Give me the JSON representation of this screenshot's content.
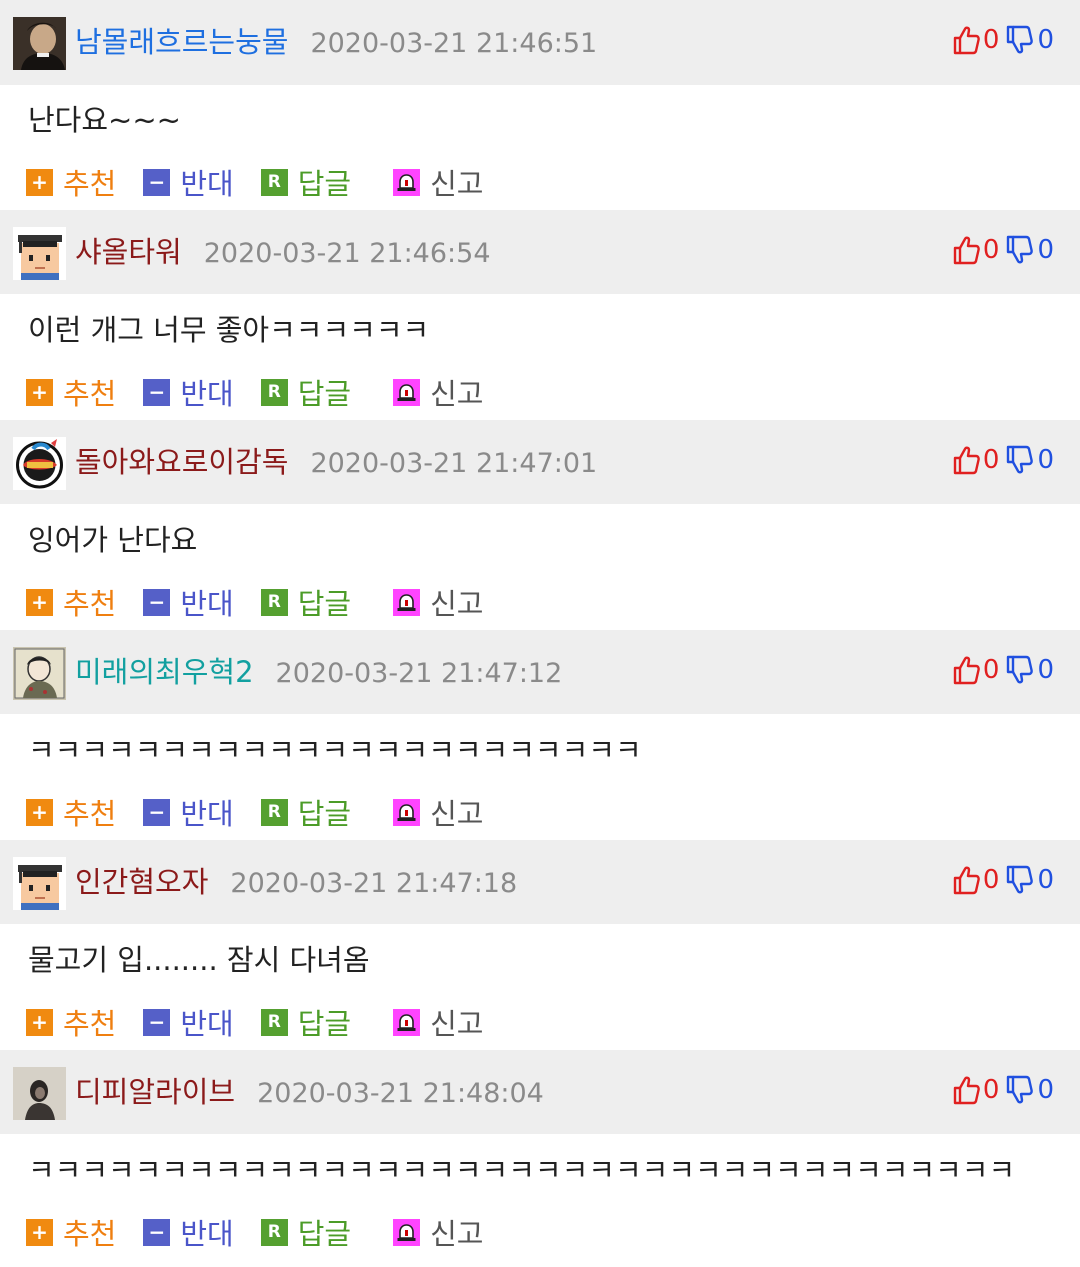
{
  "colors": {
    "header_bg": "#eeeeee",
    "timestamp": "#8a8a8a",
    "upvote": "#e02020",
    "downvote": "#2050e0",
    "recommend": "#f08a10",
    "oppose": "#5560c8",
    "reply": "#55a030",
    "report_icon": "#ff44ff"
  },
  "actions": {
    "recommend_icon": "+",
    "recommend_label": "추천",
    "oppose_icon": "−",
    "oppose_label": "반대",
    "reply_icon": "R",
    "reply_label": "답글",
    "report_icon": "siren-icon",
    "report_label": "신고"
  },
  "comments": [
    {
      "username": "남몰래흐르는눙물",
      "username_color": "#1e6fe0",
      "avatar": "portrait-photo-avatar",
      "timestamp": "2020-03-21 21:46:51",
      "upvotes": "0",
      "downvotes": "0",
      "text": "난다요~~~"
    },
    {
      "username": "샤올타워",
      "username_color": "#8b1a1a",
      "avatar": "graduate-cap-avatar",
      "timestamp": "2020-03-21 21:46:54",
      "upvotes": "0",
      "downvotes": "0",
      "text": "이런 개그 너무 좋아ㅋㅋㅋㅋㅋㅋ"
    },
    {
      "username": "돌아와요로이감독",
      "username_color": "#8b1a1a",
      "avatar": "giants-logo-avatar",
      "timestamp": "2020-03-21 21:47:01",
      "upvotes": "0",
      "downvotes": "0",
      "text": "잉어가 난다요"
    },
    {
      "username": "미래의최우혁2",
      "username_color": "#12a0a0",
      "avatar": "illustration-avatar",
      "timestamp": "2020-03-21 21:47:12",
      "upvotes": "0",
      "downvotes": "0",
      "text": "ㅋㅋㅋㅋㅋㅋㅋㅋㅋㅋㅋㅋㅋㅋㅋㅋㅋㅋㅋㅋㅋㅋㅋ"
    },
    {
      "username": "인간혐오자",
      "username_color": "#8b1a1a",
      "avatar": "graduate-cap-avatar",
      "timestamp": "2020-03-21 21:47:18",
      "upvotes": "0",
      "downvotes": "0",
      "text": "물고기 입........ 잠시 다녀옴"
    },
    {
      "username": "디피알라이브",
      "username_color": "#8b1a1a",
      "avatar": "photo-avatar",
      "timestamp": "2020-03-21 21:48:04",
      "upvotes": "0",
      "downvotes": "0",
      "text": "ㅋㅋㅋㅋㅋㅋㅋㅋㅋㅋㅋㅋㅋㅋㅋㅋㅋㅋㅋㅋㅋㅋㅋㅋㅋㅋㅋㅋㅋㅋㅋㅋㅋㅋㅋㅋㅋ"
    }
  ]
}
